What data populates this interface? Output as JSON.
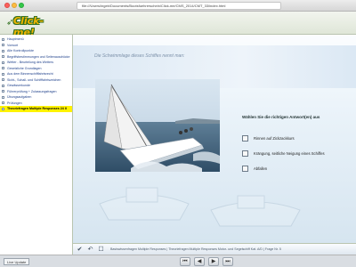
{
  "browser": {
    "url": "file:///Users/ingeb/Documents/Bootsfuehrerschein/Click-me/CMS_2014/CMT_33/index.html"
  },
  "app": {
    "logo_text": "Click-me!"
  },
  "sidebar": {
    "items": [
      {
        "label": "Hauptmenü"
      },
      {
        "label": "Vorwort"
      },
      {
        "label": "Alle Kontrollpunkte"
      },
      {
        "label": "Begriffsbestimmungen und Seitenausdrücke"
      },
      {
        "label": "Wetter - Beurteilung des Wetters"
      },
      {
        "label": "Gesetzliche Grundlagen"
      },
      {
        "label": "Aus dem Binnenschifffahrtsrecht"
      },
      {
        "label": "Sicht-, Schall- und Schifffahrtszeichen"
      },
      {
        "label": "Gewässerkunde"
      },
      {
        "label": "Führerprüfung + Zulassungsfragen"
      },
      {
        "label": "Übungsaufgaben"
      },
      {
        "label": "Prüfungen"
      },
      {
        "label": "Theoriefragen Multiple Responses 24 II",
        "active": true
      }
    ]
  },
  "main": {
    "question": "Die Schwimmlage dieses Schiffes nennt man:",
    "answers_heading": "Wählen Sie die richtigen Antwort(en) aus",
    "answers": [
      {
        "label": "Rinnen auf Zickzackkurs"
      },
      {
        "label": "Krängung, seitliche Neigung eines Schiffes"
      },
      {
        "label": "Abfallen"
      }
    ]
  },
  "footer": {
    "breadcrumb": "Basiswissenfragen Multiple Responses | Theoriefragen Multiple Responses Motor- und Segelschiff Kat. A/D | Frage Nr. 5"
  },
  "statusbar": {
    "left_label": "Live Update"
  },
  "colors": {
    "accent_yellow": "#fff200",
    "link_blue": "#1d3f8a"
  }
}
